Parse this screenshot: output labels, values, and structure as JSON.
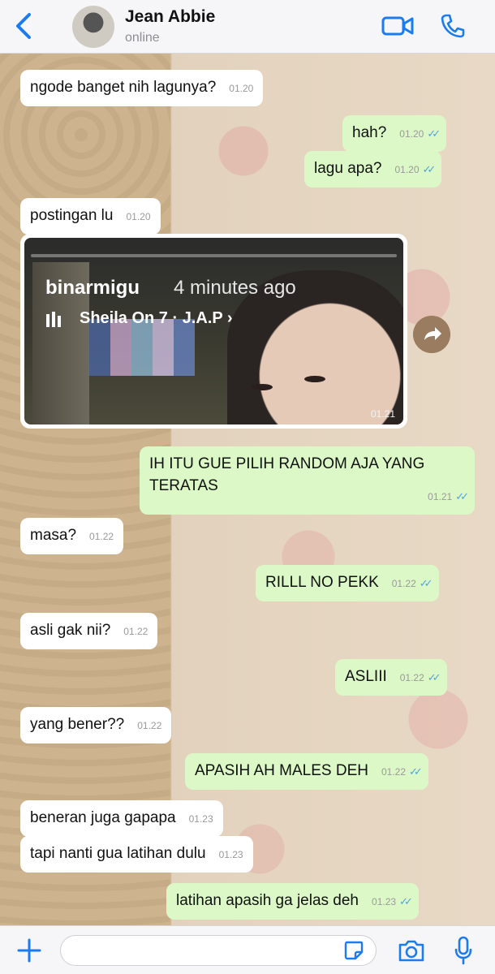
{
  "header": {
    "contact_name": "Jean Abbie",
    "status": "online"
  },
  "messages": [
    {
      "dir": "in",
      "text": "ngode banget nih lagunya?",
      "time": "01.20"
    },
    {
      "dir": "out",
      "text": "hah?",
      "time": "01.20"
    },
    {
      "dir": "out",
      "text": "lagu apa?",
      "time": "01.20"
    },
    {
      "dir": "in",
      "text": "postingan lu",
      "time": "01.20"
    },
    {
      "dir": "out",
      "text": "IH ITU GUE PILIH RANDOM AJA YANG TERATAS",
      "time": "01.21"
    },
    {
      "dir": "in",
      "text": "masa?",
      "time": "01.22"
    },
    {
      "dir": "out",
      "text": "RILLL NO PEKK",
      "time": "01.22"
    },
    {
      "dir": "in",
      "text": "asli gak nii?",
      "time": "01.22"
    },
    {
      "dir": "out",
      "text": "ASLIII",
      "time": "01.22"
    },
    {
      "dir": "in",
      "text": "yang bener??",
      "time": "01.22"
    },
    {
      "dir": "out",
      "text": "APASIH AH MALES DEH",
      "time": "01.22"
    },
    {
      "dir": "in",
      "text": "beneran juga gapapa",
      "time": "01.23"
    },
    {
      "dir": "in",
      "text": "tapi nanti gua latihan dulu",
      "time": "01.23"
    },
    {
      "dir": "out",
      "text": "latihan apasih ga jelas deh",
      "time": "01.23"
    }
  ],
  "media": {
    "username": "binarmigu",
    "posted": "4 minutes ago",
    "music": "Sheila On 7 · J.A.P",
    "time": "01.21"
  },
  "composer": {
    "value": "",
    "placeholder": ""
  },
  "colors": {
    "accent": "#1a7cf0",
    "outgoing_bubble": "#dcf8c6",
    "incoming_bubble": "#ffffff",
    "read_ticks": "#4fa3e6"
  },
  "icons": {
    "back": "chevron-left-icon",
    "video": "video-camera-icon",
    "call": "phone-icon",
    "forward": "share-forward-icon",
    "attach": "plus-icon",
    "sticker": "sticker-icon",
    "camera": "camera-icon",
    "mic": "microphone-icon"
  }
}
